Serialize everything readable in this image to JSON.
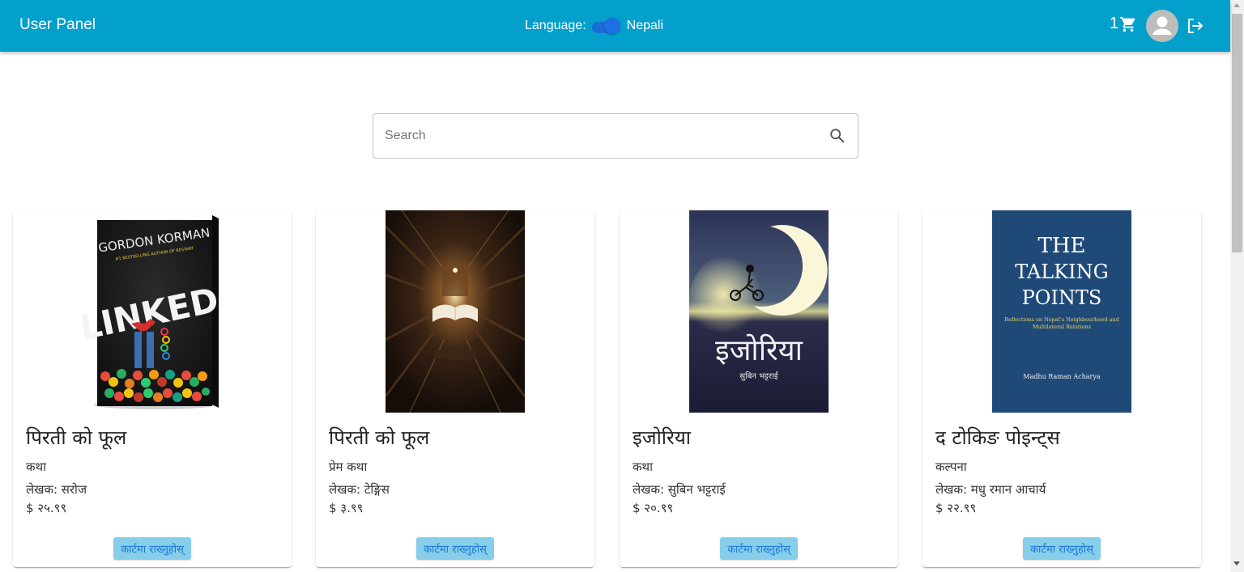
{
  "header": {
    "title": "User Panel",
    "language_label": "Language:",
    "language_value": "Nepali",
    "cart_count": "1"
  },
  "search": {
    "placeholder": "Search"
  },
  "products": [
    {
      "title": "पिरती को फूल",
      "genre": "कथा",
      "author": "लेखक: सरोज",
      "price": "$ २५.९९",
      "button": "कार्टमा राख्नुहोस्",
      "cover": {
        "author_line": "GORDON KORMAN",
        "tagline": "#1 BESTSELLING AUTHOR OF RESTART",
        "title": "LINKED"
      }
    },
    {
      "title": "पिरती को फूल",
      "genre": "प्रेम कथा",
      "author": "लेखक: टेङ्गिस",
      "price": "$ ३.९९",
      "button": "कार्टमा राख्नुहोस्"
    },
    {
      "title": "इजोरिया",
      "genre": "कथा",
      "author": "लेखक: सुबिन भट्टराई",
      "price": "$ २०.९९",
      "button": "कार्टमा राख्नुहोस्",
      "cover": {
        "title": "इजोरिया",
        "author_line": "सुबिन भट्टराई"
      }
    },
    {
      "title": "द टोकिङ पोइन्ट्स",
      "genre": "कल्पना",
      "author": "लेखक: मधु रमान आचार्य",
      "price": "$ २२.९९",
      "button": "कार्टमा राख्नुहोस्",
      "cover": {
        "title_1": "THE",
        "title_2": "TALKING",
        "title_3": "POINTS",
        "subtitle": "Reflections on Nepal's Neighbourhood and Multilateral Relations",
        "author_line": "Madhu Raman Acharya"
      }
    }
  ],
  "colors": {
    "appbar": "#03a0cc",
    "button_bg": "#87ceeb",
    "button_text": "#1976d2",
    "switch": "#1e6fe6"
  },
  "icons": [
    "shopping-cart-icon",
    "account-circle-icon",
    "logout-icon",
    "search-icon"
  ]
}
